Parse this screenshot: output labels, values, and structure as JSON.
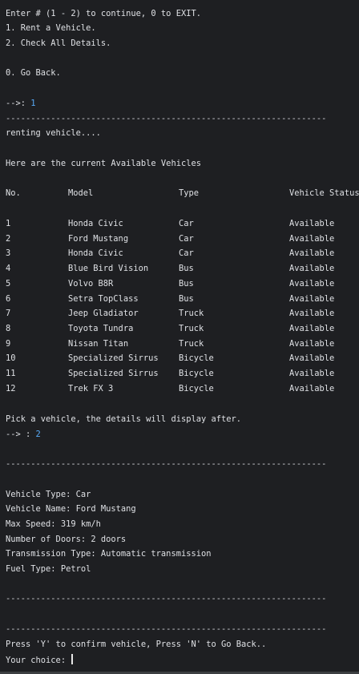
{
  "menu": {
    "prompt": "Enter # (1 - 2) to continue, 0 to EXIT.",
    "option1": "1. Rent a Vehicle.",
    "option2": "2. Check All Details.",
    "option0": "0. Go Back.",
    "input_prefix": "-->: ",
    "input_value": "1"
  },
  "separator": "----------------------------------------------------------------",
  "renting_msg": "renting vehicle....",
  "available_header": "Here are the current Available Vehicles",
  "table": {
    "headers": [
      "No.",
      "Model",
      "Type",
      "Vehicle Status"
    ],
    "rows": [
      [
        "1",
        "Honda Civic",
        "Car",
        "Available"
      ],
      [
        "2",
        "Ford Mustang",
        "Car",
        "Available"
      ],
      [
        "3",
        "Honda Civic",
        "Car",
        "Available"
      ],
      [
        "4",
        "Blue Bird Vision",
        "Bus",
        "Available"
      ],
      [
        "5",
        "Volvo B8R",
        "Bus",
        "Available"
      ],
      [
        "6",
        "Setra TopClass",
        "Bus",
        "Available"
      ],
      [
        "7",
        "Jeep Gladiator",
        "Truck",
        "Available"
      ],
      [
        "8",
        "Toyota Tundra",
        "Truck",
        "Available"
      ],
      [
        "9",
        "Nissan Titan",
        "Truck",
        "Available"
      ],
      [
        "10",
        "Specialized Sirrus",
        "Bicycle",
        "Available"
      ],
      [
        "11",
        "Specialized Sirrus",
        "Bicycle",
        "Available"
      ],
      [
        "12",
        "Trek FX 3",
        "Bicycle",
        "Available"
      ]
    ]
  },
  "pick": {
    "prompt": "Pick a vehicle, the details will display after.",
    "input_prefix": "--> : ",
    "input_value": "2"
  },
  "details": {
    "type": "Vehicle Type: Car",
    "name": "Vehicle Name: Ford Mustang",
    "speed": "Max Speed: 319 km/h",
    "doors": "Number of Doors: 2 doors",
    "transmission": "Transmission Type: Automatic transmission",
    "fuel": "Fuel Type: Petrol"
  },
  "confirm": {
    "prompt": "Press 'Y' to confirm vehicle, Press 'N' to Go Back..",
    "choice_label": "Your choice: "
  },
  "colors": {
    "background": "#1e1f22",
    "text": "#dfe1e5",
    "user_input": "#57aaf7"
  }
}
